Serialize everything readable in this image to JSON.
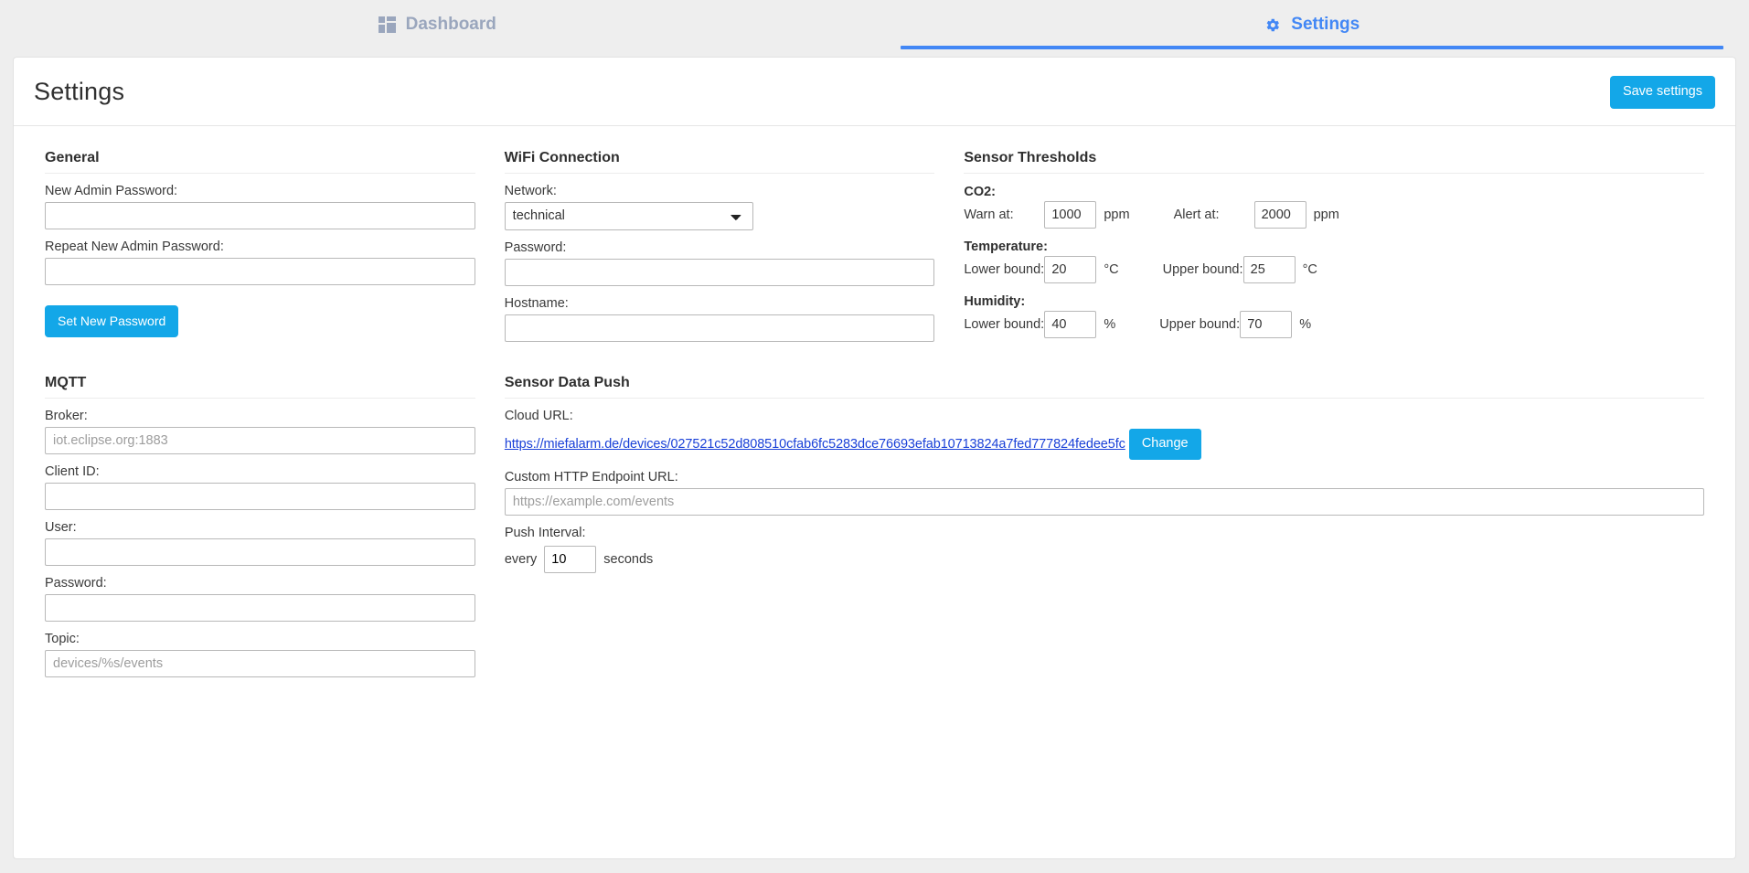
{
  "colors": {
    "accent_blue": "#4287f5",
    "button_blue": "#13a7e8",
    "link_blue": "#1a41d8",
    "page_bg": "#eeeeee",
    "inactive_tab": "#9aa6bd"
  },
  "nav": {
    "tabs": [
      {
        "label": "Dashboard",
        "icon": "dashboard-grid-icon",
        "active": false
      },
      {
        "label": "Settings",
        "icon": "gear-icon",
        "active": true
      }
    ]
  },
  "header": {
    "title": "Settings",
    "save_label": "Save settings"
  },
  "general": {
    "title": "General",
    "new_password_label": "New Admin Password:",
    "new_password_value": "",
    "repeat_password_label": "Repeat New Admin Password:",
    "repeat_password_value": "",
    "set_password_label": "Set New Password"
  },
  "wifi": {
    "title": "WiFi Connection",
    "network_label": "Network:",
    "network_selected": "technical",
    "network_options": [
      "technical"
    ],
    "password_label": "Password:",
    "password_value": "",
    "hostname_label": "Hostname:",
    "hostname_value": ""
  },
  "thresholds": {
    "title": "Sensor Thresholds",
    "groups": [
      {
        "name": "CO2:",
        "left_label": "Warn at:",
        "left_value": "1000",
        "left_unit": "ppm",
        "right_label": "Alert at:",
        "right_value": "2000",
        "right_unit": "ppm"
      },
      {
        "name": "Temperature:",
        "left_label": "Lower bound:",
        "left_value": "20",
        "left_unit": "°C",
        "right_label": "Upper bound:",
        "right_value": "25",
        "right_unit": "°C"
      },
      {
        "name": "Humidity:",
        "left_label": "Lower bound:",
        "left_value": "40",
        "left_unit": "%",
        "right_label": "Upper bound:",
        "right_value": "70",
        "right_unit": "%"
      }
    ]
  },
  "mqtt": {
    "title": "MQTT",
    "broker_label": "Broker:",
    "broker_value": "",
    "broker_placeholder": "iot.eclipse.org:1883",
    "client_id_label": "Client ID:",
    "client_id_value": "",
    "user_label": "User:",
    "user_value": "",
    "password_label": "Password:",
    "password_value": "",
    "topic_label": "Topic:",
    "topic_value": "",
    "topic_placeholder": "devices/%s/events"
  },
  "push": {
    "title": "Sensor Data Push",
    "cloud_url_label": "Cloud URL:",
    "cloud_url": "https://miefalarm.de/devices/027521c52d808510cfab6fc5283dce76693efab10713824a7fed777824fedee5fc",
    "change_label": "Change",
    "custom_endpoint_label": "Custom HTTP Endpoint URL:",
    "custom_endpoint_value": "",
    "custom_endpoint_placeholder": "https://example.com/events",
    "interval_label": "Push Interval:",
    "interval_prefix": "every",
    "interval_value": "10",
    "interval_suffix": "seconds"
  }
}
